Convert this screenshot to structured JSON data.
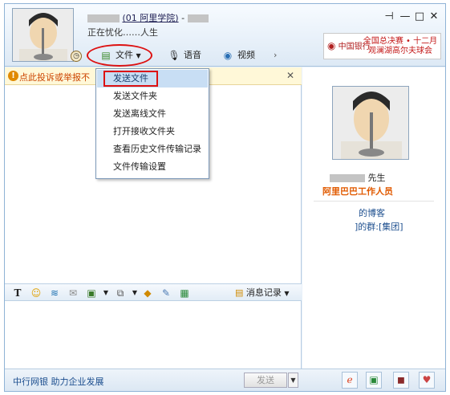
{
  "header": {
    "name_masked": "",
    "group_link": "(01 阿里学院)",
    "name_suffix": "-",
    "status": "正在忧化……人生"
  },
  "window_controls": {
    "pin": "⊣",
    "minimize": "—",
    "maximize": "□",
    "close": "✕"
  },
  "toolbar": {
    "file": "文件",
    "voice": "语音",
    "video": "视频",
    "more": "›"
  },
  "ad": {
    "logo": "中国银行",
    "line1": "全国总决赛 • 十二月",
    "line2": "观澜湖高尔夫球会"
  },
  "warning": {
    "text": "点此投诉或举报不",
    "close": "✕"
  },
  "file_menu": [
    {
      "label": "发送文件",
      "selected": true
    },
    {
      "label": "发送文件夹"
    },
    {
      "label": "发送离线文件"
    },
    {
      "label": "打开接收文件夹"
    },
    {
      "label": "查看历史文件传输记录"
    },
    {
      "label": "文件传输设置"
    }
  ],
  "format_bar": {
    "msg_record": "消息记录"
  },
  "bottom": {
    "bank": "中行网银 助力企业发展",
    "send": "发送"
  },
  "profile": {
    "title_suffix": "先生",
    "company": "阿里巴巴工作人员",
    "blog": "的博客",
    "group_prefix": "]的群:",
    "group_link": "[集团]"
  }
}
